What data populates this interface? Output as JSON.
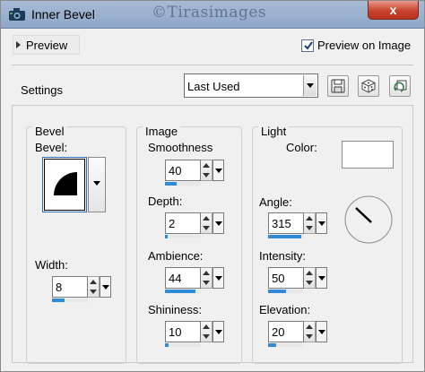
{
  "window": {
    "title": "Inner Bevel",
    "watermark": "©Tirasimages",
    "close_label": "x"
  },
  "preview": {
    "toggle_label": "Preview",
    "on_image_label": "Preview on Image",
    "on_image_checked": true
  },
  "settings": {
    "label": "Settings",
    "preset_value": "Last Used"
  },
  "bevel_group": {
    "title": "Bevel",
    "bevel_label": "Bevel:",
    "width_label": "Width:",
    "width_value": "8",
    "width_fraction": 0.35
  },
  "image_group": {
    "title": "Image",
    "smoothness_label": "Smoothness",
    "smoothness_value": "40",
    "smoothness_fraction": 0.32,
    "depth_label": "Depth:",
    "depth_value": "2",
    "depth_fraction": 0.08,
    "ambience_label": "Ambience:",
    "ambience_value": "44",
    "ambience_fraction": 0.85,
    "shininess_label": "Shininess:",
    "shininess_value": "10",
    "shininess_fraction": 0.1
  },
  "light_group": {
    "title": "Light",
    "color_label": "Color:",
    "color_value": "#ffffff",
    "angle_label": "Angle:",
    "angle_value": "315",
    "angle_fraction": 0.92,
    "intensity_label": "Intensity:",
    "intensity_value": "50",
    "intensity_fraction": 0.5,
    "elevation_label": "Elevation:",
    "elevation_value": "20",
    "elevation_fraction": 0.22
  },
  "icons": {
    "app": "camera-icon",
    "save_preset": "floppy-disk-icon",
    "randomize": "dice-icon",
    "reset": "reset-defaults-icon"
  },
  "colors": {
    "accent": "#2f8bd8",
    "close": "#c8432d"
  }
}
